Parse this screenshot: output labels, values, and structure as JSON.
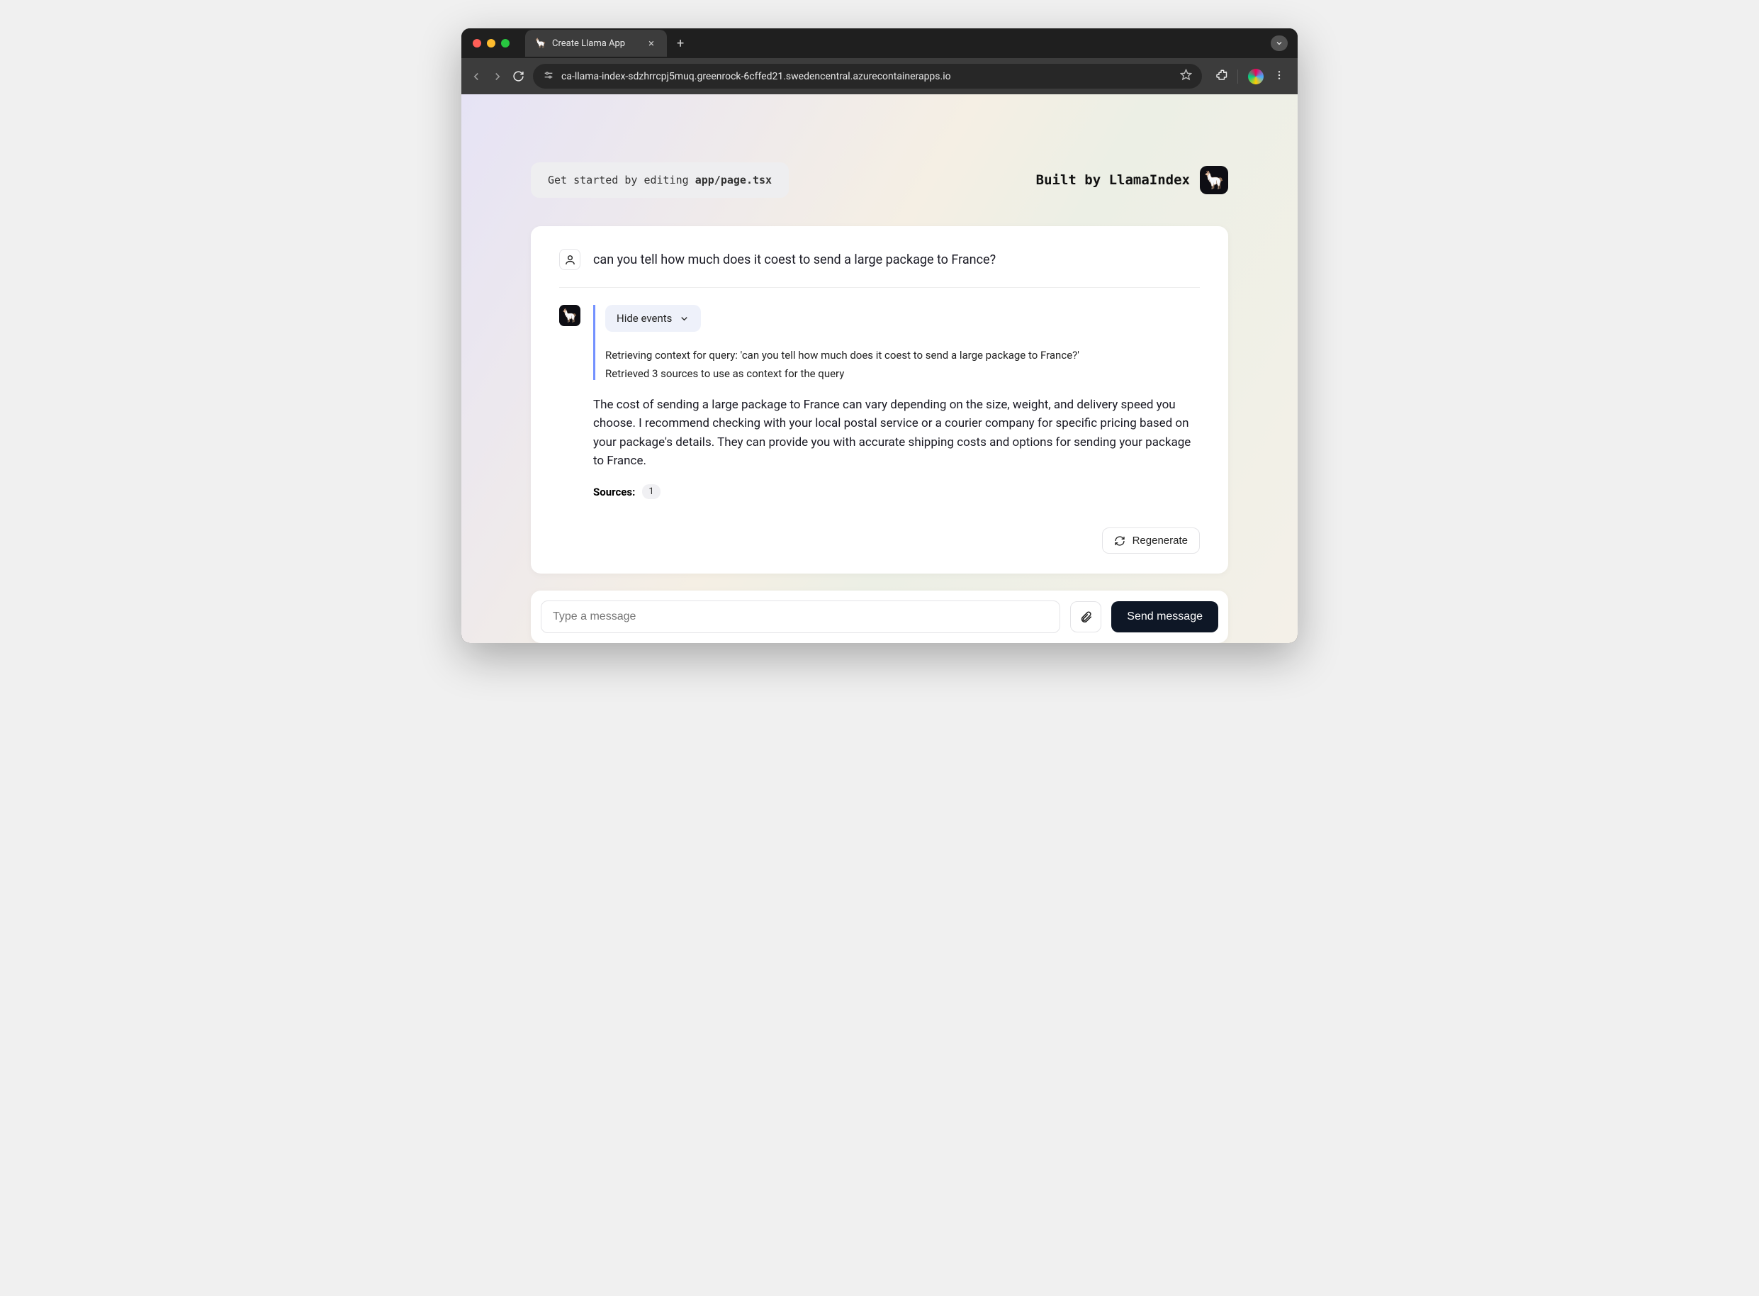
{
  "browser": {
    "tab_title": "Create Llama App",
    "url": "ca-llama-index-sdzhrrcpj5muq.greenrock-6cffed21.swedencentral.azurecontainerapps.io"
  },
  "header": {
    "getstarted_prefix": "Get started by editing ",
    "getstarted_file": "app/page.tsx",
    "builtby": "Built by LlamaIndex"
  },
  "chat": {
    "user_message": "can you tell how much does it coest to send a large package to France?",
    "hide_events_label": "Hide events",
    "events": [
      "Retrieving context for query: 'can you tell how much does it coest to send a large package to France?'",
      "Retrieved 3 sources to use as context for the query"
    ],
    "answer": "The cost of sending a large package to France can vary depending on the size, weight, and delivery speed you choose. I recommend checking with your local postal service or a courier company for specific pricing based on your package's details. They can provide you with accurate shipping costs and options for sending your package to France.",
    "sources_label": "Sources:",
    "sources_count": "1",
    "regenerate_label": "Regenerate"
  },
  "composer": {
    "placeholder": "Type a message",
    "send_label": "Send message"
  }
}
